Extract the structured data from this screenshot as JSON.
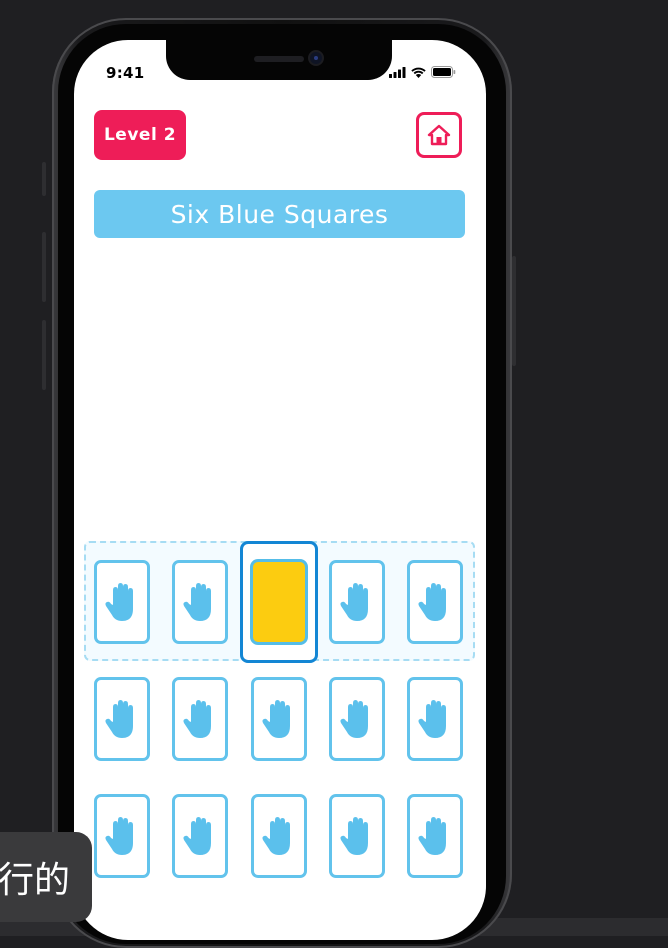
{
  "status_bar": {
    "time": "9:41"
  },
  "game": {
    "level_label": "Level 2",
    "title": "Six Blue Squares",
    "home_icon": "home-icon",
    "card_icon": "hand-icon",
    "rows": [
      [
        "hand",
        "hand",
        "selected",
        "hand",
        "hand"
      ],
      [
        "hand",
        "hand",
        "hand",
        "hand",
        "hand"
      ],
      [
        "hand",
        "hand",
        "hand",
        "hand",
        "hand"
      ]
    ],
    "selected_card_color": "#FCCC10"
  },
  "colors": {
    "accent_pink": "#EE1D58",
    "accent_blue": "#6CC8F0",
    "card_border": "#62C3EC"
  },
  "overlay": {
    "text": "行的"
  }
}
